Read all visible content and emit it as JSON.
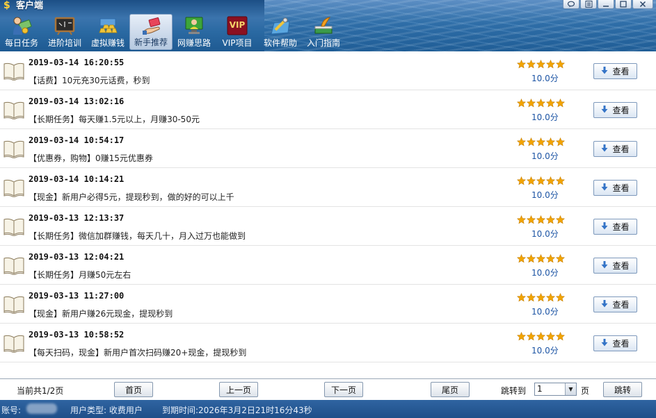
{
  "window": {
    "title": "客户端",
    "title_icon": "$",
    "buttons": [
      "chat-icon",
      "menu-icon",
      "minimize-icon",
      "maximize-icon",
      "close-icon"
    ]
  },
  "toolbar": {
    "items": [
      {
        "label": "每日任务",
        "icon": "money-person-icon",
        "active": false
      },
      {
        "label": "进阶培训",
        "icon": "chalkboard-icon",
        "active": false
      },
      {
        "label": "虚拟赚钱",
        "icon": "gold-bars-icon",
        "active": false
      },
      {
        "label": "新手推荐",
        "icon": "hand-card-icon",
        "active": true
      },
      {
        "label": "网赚思路",
        "icon": "monitor-person-icon",
        "active": false
      },
      {
        "label": "VIP项目",
        "icon": "vip-badge-icon",
        "active": false
      },
      {
        "label": "软件帮助",
        "icon": "help-tool-icon",
        "active": false
      },
      {
        "label": "入门指南",
        "icon": "pen-book-icon",
        "active": false
      }
    ],
    "vip_text": "VIP"
  },
  "list": {
    "items": [
      {
        "time": "2019-03-14 16:20:55",
        "desc": "【话费】10元充30元话费，秒到",
        "stars": 5,
        "score": "10.0分",
        "button": "查看"
      },
      {
        "time": "2019-03-14 13:02:16",
        "desc": "【长期任务】每天赚1.5元以上，月赚30-50元",
        "stars": 5,
        "score": "10.0分",
        "button": "查看"
      },
      {
        "time": "2019-03-14 10:54:17",
        "desc": "【优惠券，购物】0赚15元优惠券",
        "stars": 5,
        "score": "10.0分",
        "button": "查看"
      },
      {
        "time": "2019-03-14 10:14:21",
        "desc": "【现金】新用户必得5元，提现秒到，做的好的可以上千",
        "stars": 5,
        "score": "10.0分",
        "button": "查看"
      },
      {
        "time": "2019-03-13 12:13:37",
        "desc": "【长期任务】微信加群赚钱，每天几十，月入过万也能做到",
        "stars": 5,
        "score": "10.0分",
        "button": "查看"
      },
      {
        "time": "2019-03-13 12:04:21",
        "desc": "【长期任务】月赚50元左右",
        "stars": 5,
        "score": "10.0分",
        "button": "查看"
      },
      {
        "time": "2019-03-13 11:27:00",
        "desc": "【现金】新用户赚26元现金，提现秒到",
        "stars": 5,
        "score": "10.0分",
        "button": "查看"
      },
      {
        "time": "2019-03-13 10:58:52",
        "desc": "【每天扫码，现金】新用户首次扫码赚20+现金，提现秒到",
        "stars": 5,
        "score": "10.0分",
        "button": "查看"
      }
    ]
  },
  "pager": {
    "info": "当前共1/2页",
    "first": "首页",
    "prev": "上一页",
    "next": "下一页",
    "last": "尾页",
    "jump_label": "跳转到",
    "jump_value": "1",
    "unit": "页",
    "go": "跳转"
  },
  "status": {
    "account_label": "账号:",
    "user_type": "用户类型: 收费用户",
    "expire": "到期时间:2026年3月2日21时16分43秒"
  },
  "colors": {
    "header_blue": "#2b6aa3",
    "status_blue": "#2a5c98",
    "score_blue": "#1c54a4",
    "star_gold": "#f2a400"
  }
}
